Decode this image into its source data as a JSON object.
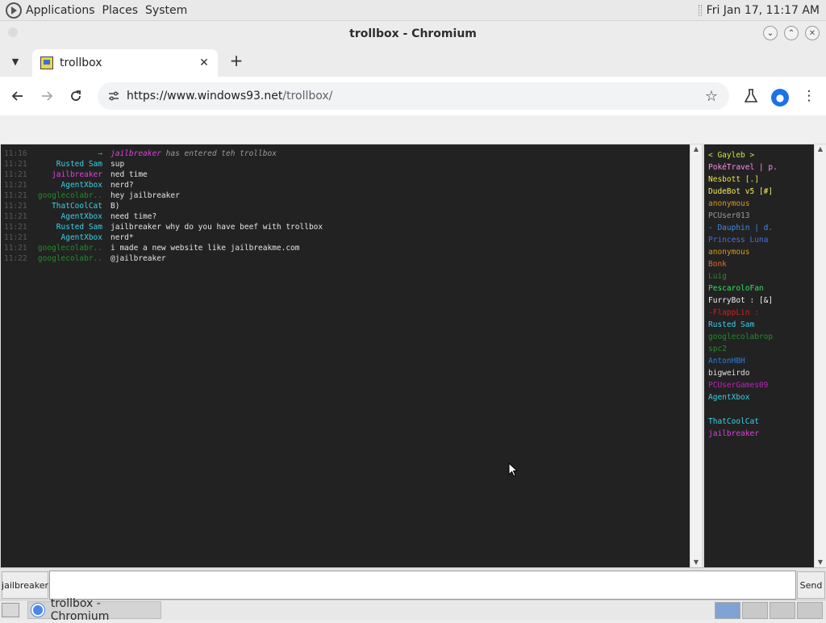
{
  "system_panel": {
    "menus": [
      "Applications",
      "Places",
      "System"
    ],
    "clock": "Fri Jan 17, 11:17 AM"
  },
  "window": {
    "title": "trollbox - Chromium"
  },
  "tabs": {
    "active_title": "trollbox",
    "close_glyph": "✕",
    "new_tab_glyph": "+"
  },
  "toolbar": {
    "url_host": "https://www.windows93.net",
    "url_path": "/trollbox/"
  },
  "chat": {
    "lines": [
      {
        "time": "11:16",
        "nick": "→",
        "nick_color": "#2cc82c",
        "msg_nick": "jailbreaker",
        "msg_nick_color": "#e040e0",
        "msg": " has entered teh trollbox",
        "system": true
      },
      {
        "time": "11:21",
        "nick": "Rusted Sam",
        "nick_color": "#3bd1e6",
        "msg": "sup"
      },
      {
        "time": "11:21",
        "nick": "jailbreaker",
        "nick_color": "#e040e0",
        "msg": "ned time"
      },
      {
        "time": "11:21",
        "nick": "AgentXbox",
        "nick_color": "#3bd1e6",
        "msg": "nerd?"
      },
      {
        "time": "11:21",
        "nick": "googlecolabr..",
        "nick_color": "#1f8f2a",
        "msg": "hey jailbreaker"
      },
      {
        "time": "11:21",
        "nick": "ThatCoolCat",
        "nick_color": "#3bd1e6",
        "msg": "B)"
      },
      {
        "time": "11:21",
        "nick": "AgentXbox",
        "nick_color": "#3bd1e6",
        "msg": "need time?"
      },
      {
        "time": "11:21",
        "nick": "Rusted Sam",
        "nick_color": "#3bd1e6",
        "msg": "jailbreaker why do you have beef with trollbox"
      },
      {
        "time": "11:21",
        "nick": "AgentXbox",
        "nick_color": "#3bd1e6",
        "msg": "nerd*"
      },
      {
        "time": "11:21",
        "nick": "googlecolabr..",
        "nick_color": "#1f8f2a",
        "msg": "i made a new website like jailbreakme.com"
      },
      {
        "time": "11:22",
        "nick": "googlecolabr..",
        "nick_color": "#1f8f2a",
        "msg": "@jailbreaker"
      }
    ]
  },
  "users": [
    {
      "name": "< Gayleb >",
      "color": "#c8e64a"
    },
    {
      "name": "PokéTravel | p.",
      "color": "#ff8cf0"
    },
    {
      "name": "Nesbott [.]",
      "color": "#f0e24a"
    },
    {
      "name": "DudeBot v5 [#]",
      "color": "#f5ee60"
    },
    {
      "name": "anonymous",
      "color": "#d49a20"
    },
    {
      "name": "PCUser013",
      "color": "#9a9a9a"
    },
    {
      "name": "- Dauphin | d.",
      "color": "#3a8de6"
    },
    {
      "name": "Princess Luna",
      "color": "#4a6fe0"
    },
    {
      "name": "anonymous",
      "color": "#d49a20"
    },
    {
      "name": "Bonk",
      "color": "#e06a2a"
    },
    {
      "name": "Luig",
      "color": "#2a8a2a"
    },
    {
      "name": "PescaroloFan",
      "color": "#30e060"
    },
    {
      "name": "FurryBot : [&]",
      "color": "#f0f0f0"
    },
    {
      "name": "-FlappLin :",
      "color": "#d02020"
    },
    {
      "name": "Rusted Sam",
      "color": "#3bd1e6"
    },
    {
      "name": "googlecolabrop",
      "color": "#1f8f2a"
    },
    {
      "name": "spc2",
      "color": "#1f8f2a"
    },
    {
      "name": "AntonHBH",
      "color": "#2a7de0"
    },
    {
      "name": "bigweirdo",
      "color": "#e0e0e0"
    },
    {
      "name": "PCUserGames09",
      "color": "#c020c0"
    },
    {
      "name": "AgentXbox",
      "color": "#3bd1e6"
    },
    {
      "name": "",
      "color": "#222222"
    },
    {
      "name": "ThatCoolCat",
      "color": "#3bd1e6"
    },
    {
      "name": "jailbreaker",
      "color": "#e040e0"
    }
  ],
  "input": {
    "nick_label": "jailbreaker",
    "value": "",
    "send_label": "Send"
  },
  "taskbar": {
    "item_label": "trollbox - Chromium"
  }
}
